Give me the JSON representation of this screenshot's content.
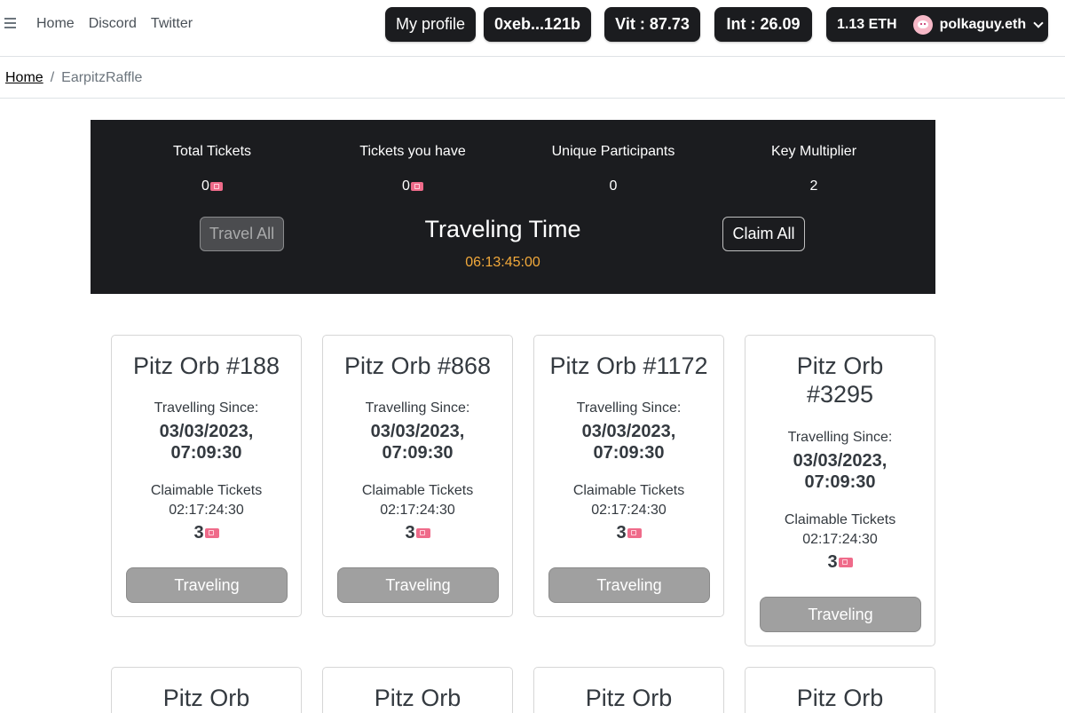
{
  "nav": {
    "links": [
      "Home",
      "Discord",
      "Twitter"
    ],
    "profile_label": "My profile",
    "wallet_short": "0xeb...121b",
    "vit": "Vit : 87.73",
    "int": "Int : 26.09",
    "eth_balance": "1.13 ETH",
    "account_name": "polkaguy.eth"
  },
  "breadcrumb": {
    "home": "Home",
    "separator": "/",
    "current": "EarpitzRaffle"
  },
  "stats": {
    "total_tickets_label": "Total Tickets",
    "total_tickets_value": "0",
    "tickets_you_have_label": "Tickets you have",
    "tickets_you_have_value": "0",
    "unique_participants_label": "Unique Participants",
    "unique_participants_value": "0",
    "key_multiplier_label": "Key Multiplier",
    "key_multiplier_value": "2",
    "travel_all_label": "Travel All",
    "claim_all_label": "Claim All",
    "traveling_title": "Traveling Time",
    "traveling_time": "06:13:45:00"
  },
  "cards": [
    {
      "title_line1": "Pitz Orb #188",
      "title_line2": "",
      "since_label": "Travelling Since:",
      "since_date": "03/03/2023,",
      "since_time": "07:09:30",
      "claimable_label": "Claimable Tickets",
      "claimable_time": "02:17:24:30",
      "tickets": "3",
      "button_label": "Traveling"
    },
    {
      "title_line1": "Pitz Orb #868",
      "title_line2": "",
      "since_label": "Travelling Since:",
      "since_date": "03/03/2023,",
      "since_time": "07:09:30",
      "claimable_label": "Claimable Tickets",
      "claimable_time": "02:17:24:30",
      "tickets": "3",
      "button_label": "Traveling"
    },
    {
      "title_line1": "Pitz Orb #1172",
      "title_line2": "",
      "since_label": "Travelling Since:",
      "since_date": "03/03/2023,",
      "since_time": "07:09:30",
      "claimable_label": "Claimable Tickets",
      "claimable_time": "02:17:24:30",
      "tickets": "3",
      "button_label": "Traveling"
    },
    {
      "title_line1": "Pitz Orb",
      "title_line2": "#3295",
      "since_label": "Travelling Since:",
      "since_date": "03/03/2023,",
      "since_time": "07:09:30",
      "claimable_label": "Claimable Tickets",
      "claimable_time": "02:17:24:30",
      "tickets": "3",
      "button_label": "Traveling"
    },
    {
      "title_line1": "Pitz Orb"
    },
    {
      "title_line1": "Pitz Orb"
    },
    {
      "title_line1": "Pitz Orb"
    },
    {
      "title_line1": "Pitz Orb"
    }
  ]
}
